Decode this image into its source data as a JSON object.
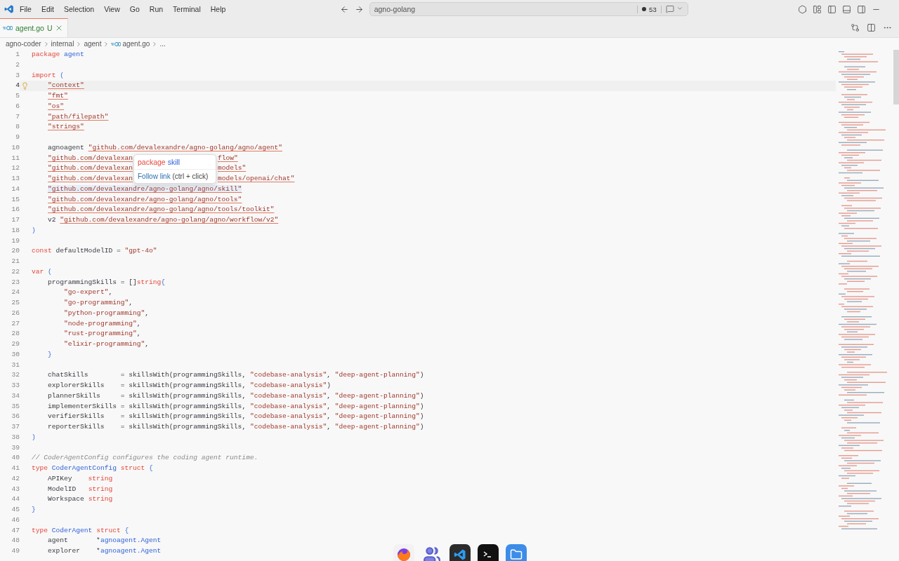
{
  "window": {
    "menu": [
      "File",
      "Edit",
      "Selection",
      "View",
      "Go",
      "Run",
      "Terminal",
      "Help"
    ],
    "search": "agno-golang",
    "badge": "53"
  },
  "tabs": [
    {
      "label": "agent.go",
      "status": "U",
      "selected": true
    }
  ],
  "breadcrumb": [
    {
      "label": "agno-coder",
      "kind": "folder"
    },
    {
      "label": "internal",
      "kind": "folder"
    },
    {
      "label": "agent",
      "kind": "folder"
    },
    {
      "label": "agent.go",
      "kind": "file"
    },
    {
      "label": "...",
      "kind": "more"
    }
  ],
  "hover": {
    "keyword": "package",
    "name": "skill",
    "link": "Follow link",
    "hint": "(ctrl + click)"
  },
  "lines": [
    {
      "n": "1",
      "kind": "plain",
      "tokens": [
        {
          "kind": "keyword",
          "text": "package"
        },
        {
          "kind": "name",
          "text": " agent"
        }
      ]
    },
    {
      "n": "2",
      "kind": "plain"
    },
    {
      "n": "3",
      "kind": "plain",
      "tokens": [
        {
          "kind": "keyword",
          "text": "import"
        },
        {
          "kind": "bracket",
          "text": " ("
        }
      ]
    },
    {
      "n": "4",
      "kind": "current",
      "tokens": [
        {
          "kind": "link",
          "text": "    \"context\""
        }
      ]
    },
    {
      "n": "5",
      "kind": "plain",
      "tokens": [
        {
          "kind": "link",
          "text": "    \"fmt\""
        }
      ]
    },
    {
      "n": "6",
      "kind": "plain",
      "tokens": [
        {
          "kind": "link",
          "text": "    \"os\""
        }
      ]
    },
    {
      "n": "7",
      "kind": "plain",
      "tokens": [
        {
          "kind": "link",
          "text": "    \"path/filepath\""
        }
      ]
    },
    {
      "n": "8",
      "kind": "plain",
      "tokens": [
        {
          "kind": "link",
          "text": "    \"strings\""
        }
      ]
    },
    {
      "n": "9",
      "kind": "plain"
    },
    {
      "n": "10",
      "kind": "plain",
      "tokens": [
        {
          "kind": "plain",
          "text": "    agnoagent"
        },
        {
          "kind": "link",
          "text": " \"github.com/devalexandre/agno-golang/agno/agent\""
        }
      ]
    },
    {
      "n": "11",
      "kind": "covered",
      "tokens": [
        {
          "kind": "link",
          "text": "    \"github.com/devalexan"
        }
      ],
      "tail": [
        {
          "kind": "link",
          "text": "flow\""
        }
      ]
    },
    {
      "n": "12",
      "kind": "covered",
      "tokens": [
        {
          "kind": "link",
          "text": "    \"github.com/devalexan"
        }
      ],
      "tail": [
        {
          "kind": "link",
          "text": "models\""
        }
      ]
    },
    {
      "n": "13",
      "kind": "covered",
      "tokens": [
        {
          "kind": "link",
          "text": "    \"github.com/devalexan"
        }
      ],
      "tail": [
        {
          "kind": "link",
          "text": "models/openai/chat\""
        }
      ]
    },
    {
      "n": "14",
      "kind": "hovered",
      "tokens": [
        {
          "kind": "link",
          "text": "    \"github.com/devalexandre/agno-golang/agno/skill\""
        }
      ]
    },
    {
      "n": "15",
      "kind": "plain",
      "tokens": [
        {
          "kind": "link",
          "text": "    \"github.com/devalexandre/agno-golang/agno/tools\""
        }
      ]
    },
    {
      "n": "16",
      "kind": "plain",
      "tokens": [
        {
          "kind": "link",
          "text": "    \"github.com/devalexandre/agno-golang/agno/tools/toolkit\""
        }
      ]
    },
    {
      "n": "17",
      "kind": "plain",
      "tokens": [
        {
          "kind": "plain",
          "text": "    v2"
        },
        {
          "kind": "link",
          "text": " \"github.com/devalexandre/agno-golang/agno/workflow/v2\""
        }
      ]
    },
    {
      "n": "18",
      "kind": "plain",
      "tokens": [
        {
          "kind": "bracket",
          "text": ")"
        }
      ]
    },
    {
      "n": "19",
      "kind": "plain"
    },
    {
      "n": "20",
      "kind": "plain",
      "tokens": [
        {
          "kind": "keyword",
          "text": "const"
        },
        {
          "kind": "plain",
          "text": " defaultModelID ="
        },
        {
          "kind": "string",
          "text": " \"gpt-4o\""
        }
      ]
    },
    {
      "n": "21",
      "kind": "plain"
    },
    {
      "n": "22",
      "kind": "plain",
      "tokens": [
        {
          "kind": "keyword",
          "text": "var"
        },
        {
          "kind": "bracket",
          "text": " ("
        }
      ]
    },
    {
      "n": "23",
      "kind": "plain",
      "tokens": [
        {
          "kind": "plain",
          "text": "    programmingSkills = []"
        },
        {
          "kind": "type",
          "text": "string"
        },
        {
          "kind": "bracket",
          "text": "{"
        }
      ]
    },
    {
      "n": "24",
      "kind": "plain",
      "tokens": [
        {
          "kind": "string",
          "text": "        \"go-expert\""
        },
        {
          "kind": "plain",
          "text": ","
        }
      ]
    },
    {
      "n": "25",
      "kind": "plain",
      "tokens": [
        {
          "kind": "string",
          "text": "        \"go-programming\""
        },
        {
          "kind": "plain",
          "text": ","
        }
      ]
    },
    {
      "n": "26",
      "kind": "plain",
      "tokens": [
        {
          "kind": "string",
          "text": "        \"python-programming\""
        },
        {
          "kind": "plain",
          "text": ","
        }
      ]
    },
    {
      "n": "27",
      "kind": "plain",
      "tokens": [
        {
          "kind": "string",
          "text": "        \"node-programming\""
        },
        {
          "kind": "plain",
          "text": ","
        }
      ]
    },
    {
      "n": "28",
      "kind": "plain",
      "tokens": [
        {
          "kind": "string",
          "text": "        \"rust-programming\""
        },
        {
          "kind": "plain",
          "text": ","
        }
      ]
    },
    {
      "n": "29",
      "kind": "plain",
      "tokens": [
        {
          "kind": "string",
          "text": "        \"elixir-programming\""
        },
        {
          "kind": "plain",
          "text": ","
        }
      ]
    },
    {
      "n": "30",
      "kind": "plain",
      "tokens": [
        {
          "kind": "bracket",
          "text": "    }"
        }
      ]
    },
    {
      "n": "31",
      "kind": "plain"
    },
    {
      "n": "32",
      "kind": "plain",
      "tokens": [
        {
          "kind": "plain",
          "text": "    chatSkills        = skillsWith(programmingSkills,"
        },
        {
          "kind": "string",
          "text": " \"codebase-analysis\""
        },
        {
          "kind": "plain",
          "text": ","
        },
        {
          "kind": "string",
          "text": " \"deep-agent-planning\""
        },
        {
          "kind": "plain",
          "text": ")"
        }
      ]
    },
    {
      "n": "33",
      "kind": "plain",
      "tokens": [
        {
          "kind": "plain",
          "text": "    explorerSkills    = skillsWith(programmingSkills,"
        },
        {
          "kind": "string",
          "text": " \"codebase-analysis\""
        },
        {
          "kind": "plain",
          "text": ")"
        }
      ]
    },
    {
      "n": "34",
      "kind": "plain",
      "tokens": [
        {
          "kind": "plain",
          "text": "    plannerSkills     = skillsWith(programmingSkills,"
        },
        {
          "kind": "string",
          "text": " \"codebase-analysis\""
        },
        {
          "kind": "plain",
          "text": ","
        },
        {
          "kind": "string",
          "text": " \"deep-agent-planning\""
        },
        {
          "kind": "plain",
          "text": ")"
        }
      ]
    },
    {
      "n": "35",
      "kind": "plain",
      "tokens": [
        {
          "kind": "plain",
          "text": "    implementerSkills = skillsWith(programmingSkills,"
        },
        {
          "kind": "string",
          "text": " \"codebase-analysis\""
        },
        {
          "kind": "plain",
          "text": ","
        },
        {
          "kind": "string",
          "text": " \"deep-agent-planning\""
        },
        {
          "kind": "plain",
          "text": ")"
        }
      ]
    },
    {
      "n": "36",
      "kind": "plain",
      "tokens": [
        {
          "kind": "plain",
          "text": "    verifierSkills    = skillsWith(programmingSkills,"
        },
        {
          "kind": "string",
          "text": " \"codebase-analysis\""
        },
        {
          "kind": "plain",
          "text": ","
        },
        {
          "kind": "string",
          "text": " \"deep-agent-planning\""
        },
        {
          "kind": "plain",
          "text": ")"
        }
      ]
    },
    {
      "n": "37",
      "kind": "plain",
      "tokens": [
        {
          "kind": "plain",
          "text": "    reporterSkills    = skillsWith(programmingSkills,"
        },
        {
          "kind": "string",
          "text": " \"codebase-analysis\""
        },
        {
          "kind": "plain",
          "text": ","
        },
        {
          "kind": "string",
          "text": " \"deep-agent-planning\""
        },
        {
          "kind": "plain",
          "text": ")"
        }
      ]
    },
    {
      "n": "38",
      "kind": "plain",
      "tokens": [
        {
          "kind": "bracket",
          "text": ")"
        }
      ]
    },
    {
      "n": "39",
      "kind": "plain"
    },
    {
      "n": "40",
      "kind": "plain",
      "tokens": [
        {
          "kind": "comment",
          "text": "// CoderAgentConfig configures the coding agent runtime."
        }
      ]
    },
    {
      "n": "41",
      "kind": "plain",
      "tokens": [
        {
          "kind": "keyword",
          "text": "type"
        },
        {
          "kind": "name",
          "text": " CoderAgentConfig"
        },
        {
          "kind": "keyword",
          "text": " struct"
        },
        {
          "kind": "bracket",
          "text": " {"
        }
      ]
    },
    {
      "n": "42",
      "kind": "plain",
      "tokens": [
        {
          "kind": "plain",
          "text": "    APIKey"
        },
        {
          "kind": "type",
          "text": "    string"
        }
      ]
    },
    {
      "n": "43",
      "kind": "plain",
      "tokens": [
        {
          "kind": "plain",
          "text": "    ModelID"
        },
        {
          "kind": "type",
          "text": "   string"
        }
      ]
    },
    {
      "n": "44",
      "kind": "plain",
      "tokens": [
        {
          "kind": "plain",
          "text": "    Workspace"
        },
        {
          "kind": "type",
          "text": " string"
        }
      ]
    },
    {
      "n": "45",
      "kind": "plain",
      "tokens": [
        {
          "kind": "bracket",
          "text": "}"
        }
      ]
    },
    {
      "n": "46",
      "kind": "plain"
    },
    {
      "n": "47",
      "kind": "plain",
      "tokens": [
        {
          "kind": "keyword",
          "text": "type"
        },
        {
          "kind": "name",
          "text": " CoderAgent"
        },
        {
          "kind": "keyword",
          "text": " struct"
        },
        {
          "kind": "bracket",
          "text": " {"
        }
      ]
    },
    {
      "n": "48",
      "kind": "plain",
      "tokens": [
        {
          "kind": "plain",
          "text": "    agent       *"
        },
        {
          "kind": "name",
          "text": "agnoagent.Agent"
        }
      ]
    },
    {
      "n": "49",
      "kind": "plain",
      "tokens": [
        {
          "kind": "plain",
          "text": "    explorer    *"
        },
        {
          "kind": "name",
          "text": "agnoagent.Agent"
        }
      ]
    }
  ],
  "dock": [
    {
      "kind": "browser"
    },
    {
      "kind": "chat"
    },
    {
      "kind": "editor"
    },
    {
      "kind": "terminal"
    },
    {
      "kind": "files"
    }
  ]
}
